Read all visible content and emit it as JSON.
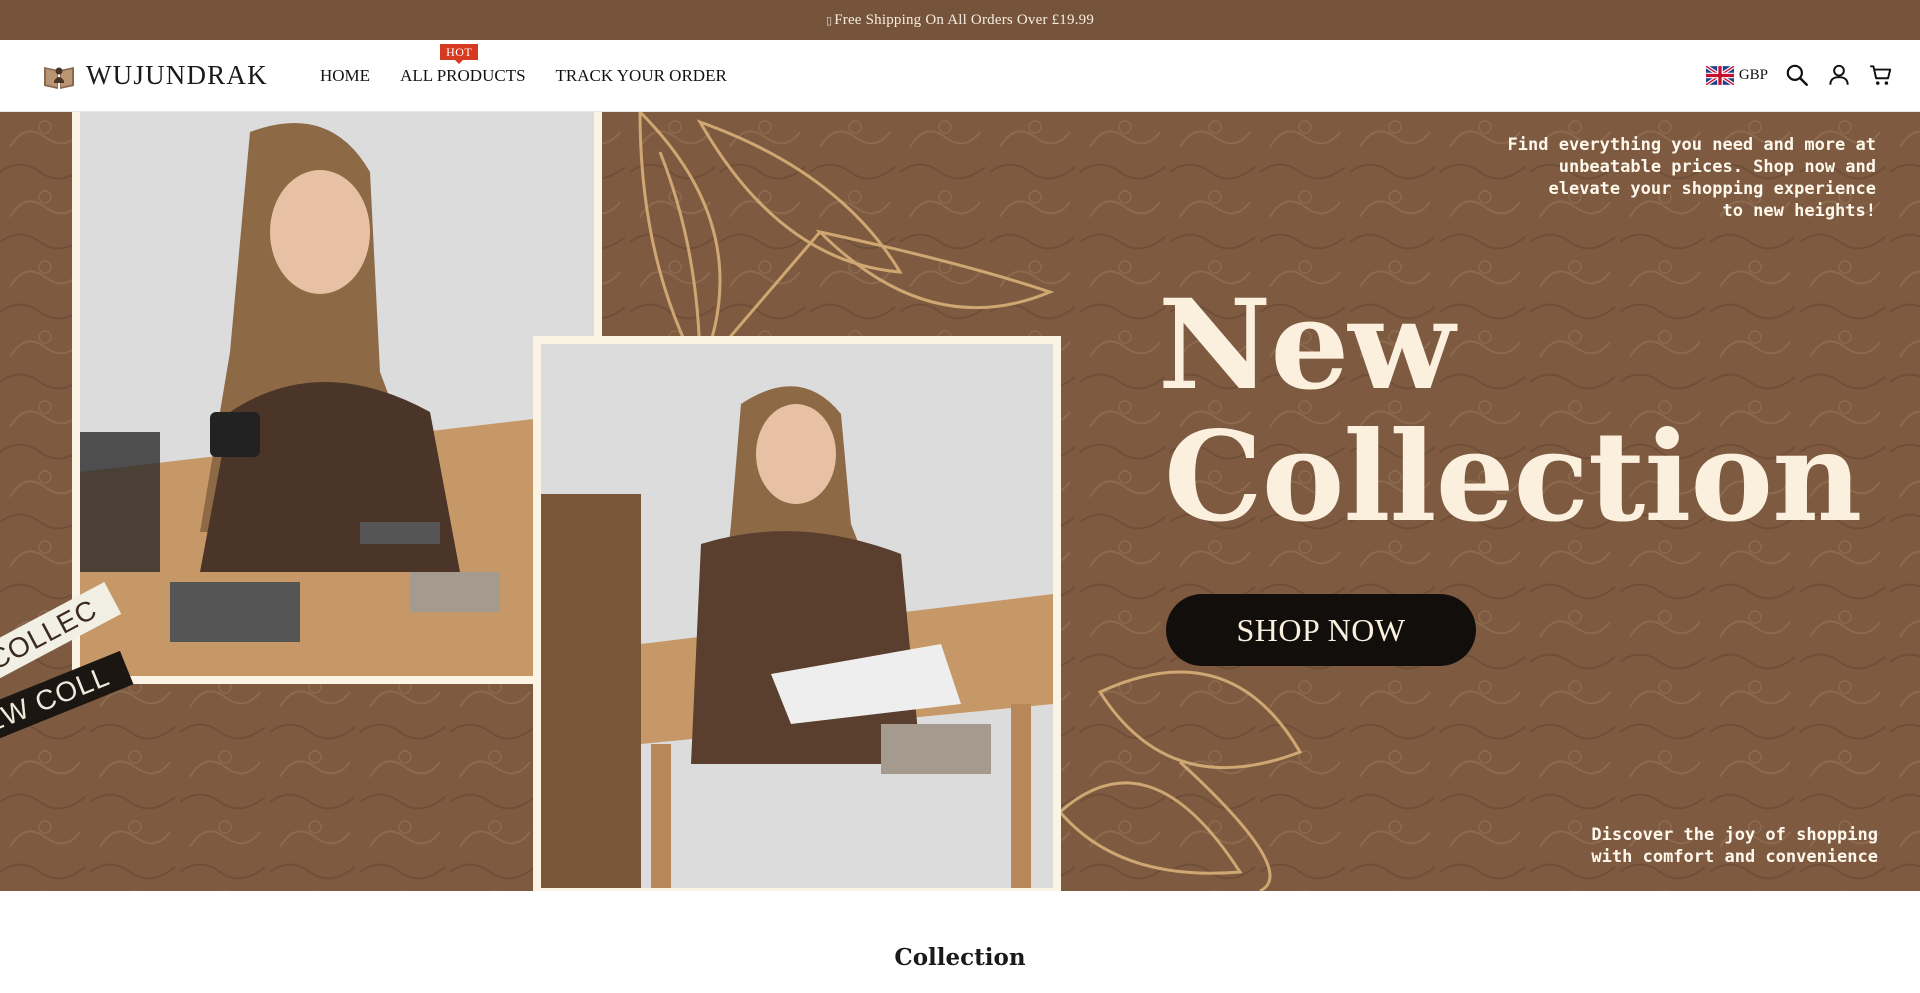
{
  "announcement": {
    "icon": "box-glyph",
    "text": "Free Shipping On All Orders Over £19.99"
  },
  "header": {
    "logo_text": "WUJUNDRAK",
    "logo_icon": "book-icon",
    "nav": [
      {
        "label": "HOME"
      },
      {
        "label": "ALL PRODUCTS",
        "badge": "HOT"
      },
      {
        "label": "TRACK YOUR ORDER"
      }
    ],
    "currency": "GBP",
    "icons": [
      "uk-flag-icon",
      "search-icon",
      "account-icon",
      "cart-icon"
    ]
  },
  "hero": {
    "tagline": "Find everything you need and more at\nunbeatable prices. Shop now and\nelevate your shopping experience\nto new heights!",
    "title_line1": "New",
    "title_line2": "Collection",
    "button_label": "SHOP NOW",
    "ribbon_1": "COLLEC",
    "ribbon_2": "EW COLL",
    "footer_text": "Discover the joy of shopping\nwith comfort and convenience"
  },
  "sections": {
    "collection_title": "Collection"
  },
  "colors": {
    "announcement_bg": "#76543b",
    "hero_bg": "#7d5a40",
    "accent_cream": "#fbf0de",
    "button_bg": "#120e0c",
    "badge_red": "#d63b1f"
  }
}
